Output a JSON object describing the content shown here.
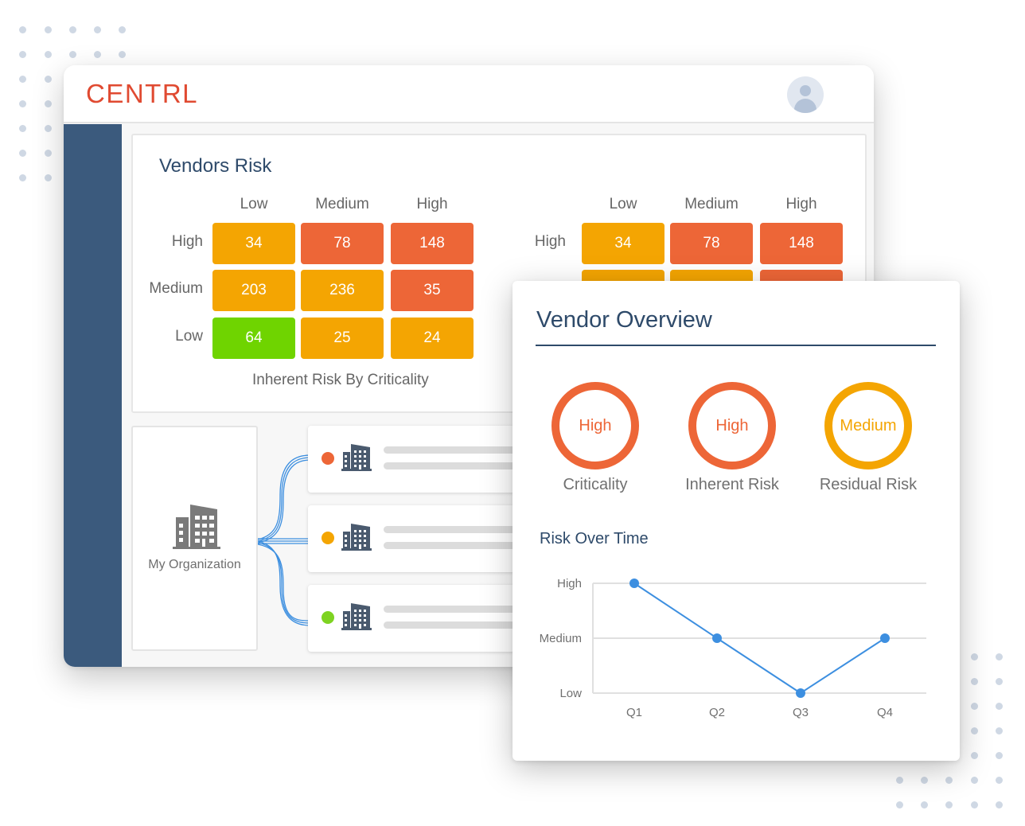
{
  "header": {
    "logo": "CENTRL",
    "avatar_icon": "user-avatar-icon"
  },
  "vendors_risk": {
    "title": "Vendors Risk",
    "heatmaps": [
      {
        "columns": [
          "Low",
          "Medium",
          "High"
        ],
        "rows": [
          "High",
          "Medium",
          "Low"
        ],
        "values": [
          [
            34,
            78,
            148
          ],
          [
            203,
            236,
            35
          ],
          [
            64,
            25,
            24
          ]
        ],
        "levels": [
          [
            "medium",
            "high",
            "high"
          ],
          [
            "medium",
            "medium",
            "high"
          ],
          [
            "low",
            "medium",
            "medium"
          ]
        ],
        "caption": "Inherent Risk By Criticality"
      },
      {
        "columns": [
          "Low",
          "Medium",
          "High"
        ],
        "rows": [
          "High"
        ],
        "values": [
          [
            34,
            78,
            148
          ]
        ],
        "levels": [
          [
            "medium",
            "high",
            "high"
          ],
          [
            "medium",
            "medium",
            "high"
          ]
        ]
      }
    ]
  },
  "organization": {
    "label": "My Organization",
    "vendors": [
      {
        "status": "high"
      },
      {
        "status": "medium"
      },
      {
        "status": "low"
      }
    ]
  },
  "vendor_overview": {
    "title": "Vendor Overview",
    "ratings": [
      {
        "label": "Criticality",
        "value": "High",
        "level": "high"
      },
      {
        "label": "Inherent Risk",
        "value": "High",
        "level": "high"
      },
      {
        "label": "Residual Risk",
        "value": "Medium",
        "level": "medium"
      }
    ],
    "risk_over_time_title": "Risk Over Time"
  },
  "colors": {
    "high": "#ed6637",
    "medium": "#f4a502",
    "low": "#6fd400",
    "dot_low": "#7ed321",
    "brand": "#e04a31",
    "sidebar": "#3b5a7d",
    "line": "#3d8fe0"
  },
  "chart_data": {
    "type": "line",
    "title": "Risk Over Time",
    "categories": [
      "Q1",
      "Q2",
      "Q3",
      "Q4"
    ],
    "y_levels": [
      "Low",
      "Medium",
      "High"
    ],
    "series": [
      {
        "name": "Risk",
        "values": [
          "High",
          "Medium",
          "Low",
          "Medium"
        ]
      }
    ],
    "xlabel": "",
    "ylabel": "",
    "grid": true
  }
}
